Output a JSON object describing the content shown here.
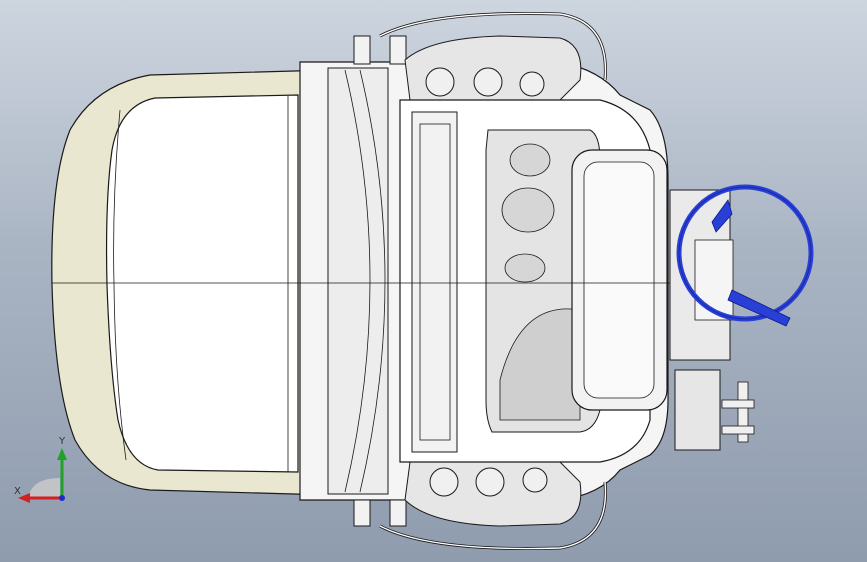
{
  "viewport": {
    "background_top": "#cdd5df",
    "background_bottom": "#8f9cae"
  },
  "model": {
    "body_color": "#f7f7f7",
    "shell_color": "#e9e7cf",
    "steering_wheel_color": "#2a3fd6",
    "line_color": "#1a1a1a"
  },
  "triad": {
    "x_label": "X",
    "y_label": "Y",
    "x_color": "#d32020",
    "y_color": "#1fa12a",
    "z_color": "#1b2bd0"
  }
}
